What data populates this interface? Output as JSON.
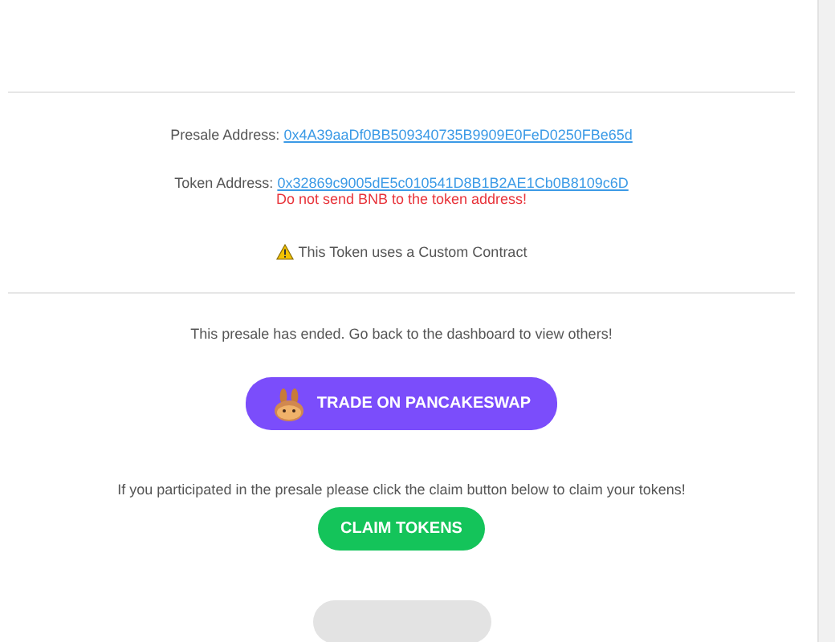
{
  "presale_address": {
    "label": "Presale Address:",
    "value": "0x4A39aaDf0BB509340735B9909E0FeD0250FBe65d"
  },
  "token_address": {
    "label": "Token Address:",
    "value": "0x32869c9005dE5c010541D8B1B2AE1Cb0B8109c6D",
    "warning": "Do not send BNB to the token address!"
  },
  "custom_contract_notice": "This Token uses a Custom Contract",
  "ended_message": "This presale has ended. Go back to the dashboard to view others!",
  "trade_button": "TRADE ON PANCAKESWAP",
  "claim_message": "If you participated in the presale please click the claim button below to claim your tokens!",
  "claim_button": "CLAIM TOKENS"
}
